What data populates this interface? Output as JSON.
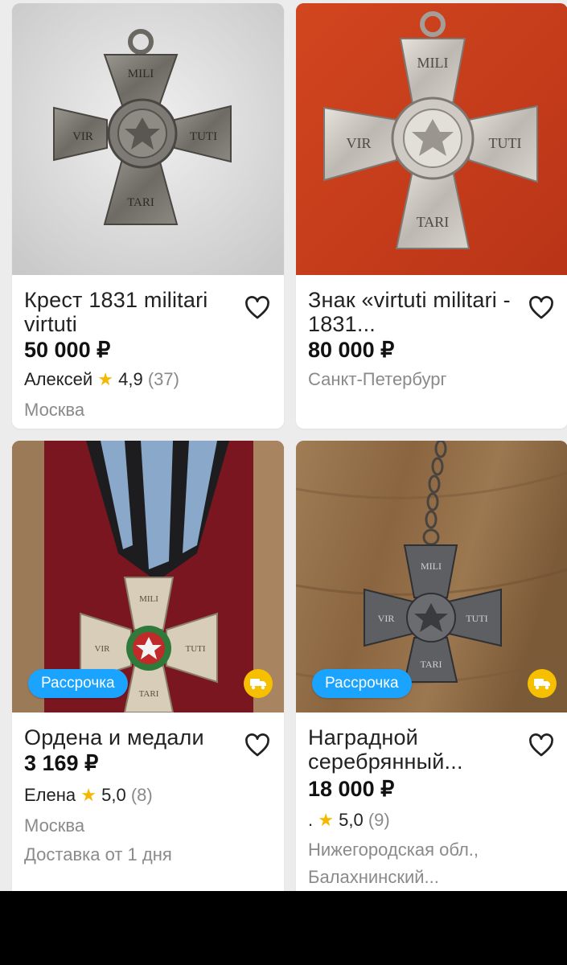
{
  "listings": [
    {
      "title": "Крест 1831 militari virtuti",
      "price": "50 000 ₽",
      "seller": "Алексей",
      "rating": "4,9",
      "reviews": "(37)",
      "location": "Москва",
      "engraving": {
        "top": "MILI",
        "left": "VIR",
        "right": "TUTI",
        "bottom": "TARI"
      }
    },
    {
      "title": "Знак «virtuti militari - 1831...",
      "price": "80 000 ₽",
      "location": "Санкт-Петербург",
      "engraving": {
        "top": "MILI",
        "left": "VIR",
        "right": "TUTI",
        "bottom": "TARI"
      }
    },
    {
      "title": "Ордена и медали",
      "price": "3 169 ₽",
      "seller": "Елена",
      "rating": "5,0",
      "reviews": "(8)",
      "location": "Москва",
      "delivery": "Доставка от 1 дня",
      "badge": "Рассрочка",
      "engraving": {
        "top": "MILI",
        "left": "VIR",
        "right": "TUTI",
        "bottom": "TARI"
      }
    },
    {
      "title": "Наградной серебрянный...",
      "price": "18 000 ₽",
      "seller": ".",
      "rating": "5,0",
      "reviews": "(9)",
      "location_line1": "Нижегородская обл.,",
      "location_line2": "Балахнинский...",
      "badge": "Рассрочка",
      "engraving": {
        "top": "MILI",
        "left": "VIR",
        "right": "TUTI",
        "bottom": "TARI"
      }
    }
  ],
  "icons": {
    "favorite": "heart-outline-icon",
    "rating": "star-icon",
    "delivery": "truck-icon"
  },
  "colors": {
    "accent_blue": "#1aa3ff",
    "star": "#f5b800",
    "delivery_badge": "#f6c000"
  }
}
